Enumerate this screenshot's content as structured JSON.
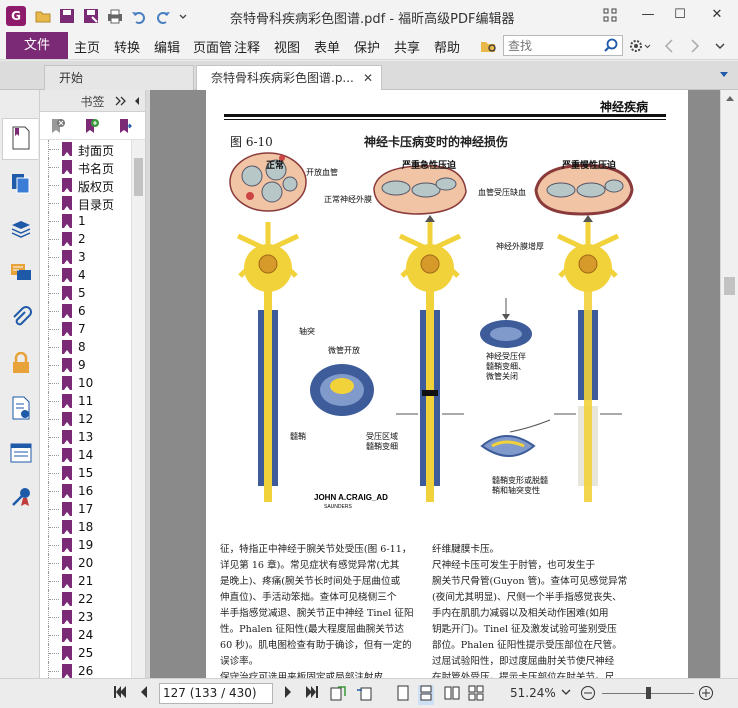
{
  "window": {
    "title": "奈特骨科疾病彩色图谱.pdf - 福昕高级PDF编辑器",
    "minimize": "—",
    "maximize": "☐",
    "close": "✕"
  },
  "menu": {
    "file": "文件",
    "items": [
      "主页",
      "转换",
      "编辑",
      "页面管",
      "注释",
      "视图",
      "表单",
      "保护",
      "共享",
      "帮助"
    ],
    "search_placeholder": "查找"
  },
  "tabs": {
    "start": "开始",
    "document": "奈特骨科疾病彩色图谱.p..."
  },
  "bookmarks": {
    "header": "书签",
    "items": [
      "封面页",
      "书名页",
      "版权页",
      "目录页",
      "1",
      "2",
      "3",
      "4",
      "5",
      "6",
      "7",
      "8",
      "9",
      "10",
      "11",
      "12",
      "13",
      "14",
      "15",
      "16",
      "17",
      "18",
      "19",
      "20",
      "21",
      "22",
      "23",
      "24",
      "25",
      "26"
    ]
  },
  "page": {
    "section": "神经疾病",
    "figure_no": "图 6-10",
    "figure_title": "神经卡压病变时的神经损伤",
    "col1": "正常",
    "col2": "严重急性压迫",
    "col3": "严重慢性压迫",
    "labels": {
      "open_vessel": "开放血管",
      "normal_epineurium": "正常神经外膜",
      "vessel_ischemia": "血管受压缺血",
      "epineurium_thick": "神经外膜增厚",
      "axon": "轴突",
      "microtubule_open": "微管开放",
      "myelin": "髓鞘",
      "compression_zone": "受压区域",
      "myelin_thin": "髓鞘变细",
      "nerve_compress": "神经受压伴",
      "myelin_thin_short": "髓鞘变细、",
      "micro_closed": "微管关闭",
      "myelin_degenerate": "髓鞘变形或脱髓",
      "axon_degenerate": "鞘和轴突变性",
      "signature": "JOHN A.CRAIG_AD",
      "publisher": "SAUNDERS"
    },
    "left_column": [
      "征，特指正中神经于腕关节处受压(图 6-11，",
      "详见第 16 章)。常见症状有感觉异常(尤其",
      "是晚上)、疼痛(腕关节长时间处于屈曲位或",
      "伸直位)、手活动笨拙。查体可见桡侧三个",
      "半手指感觉减退、腕关节正中神经 Tinel 征阳",
      "性。Phalen 征阳性(最大程度屈曲腕关节达",
      "60 秒)。肌电图检查有助于确诊，但有一定的",
      "误诊率。",
      "    保守治疗可选用夹板固定或局部注射皮"
    ],
    "right_column": [
      "纤维腱膜卡压。",
      "    尺神经卡压可发生于肘管，也可发生于",
      "腕关节尺骨管(Guyon 管)。查体可见感觉异常",
      "(夜间尤其明显)、尺侧一个半手指感觉丧失、",
      "手内在肌肌力减弱以及相关动作困难(如用",
      "钥匙开门)。Tinel 征及激发试验可鉴别受压",
      "部位。Phalen 征阳性提示受压部位在尺管。",
      "过屈试验阳性，即过度屈曲肘关节使尺神经",
      "在肘管处受压，提示卡压部位在肘关节。尺"
    ]
  },
  "status": {
    "page_field": "127 (133 / 430)",
    "zoom": "51.24%"
  }
}
